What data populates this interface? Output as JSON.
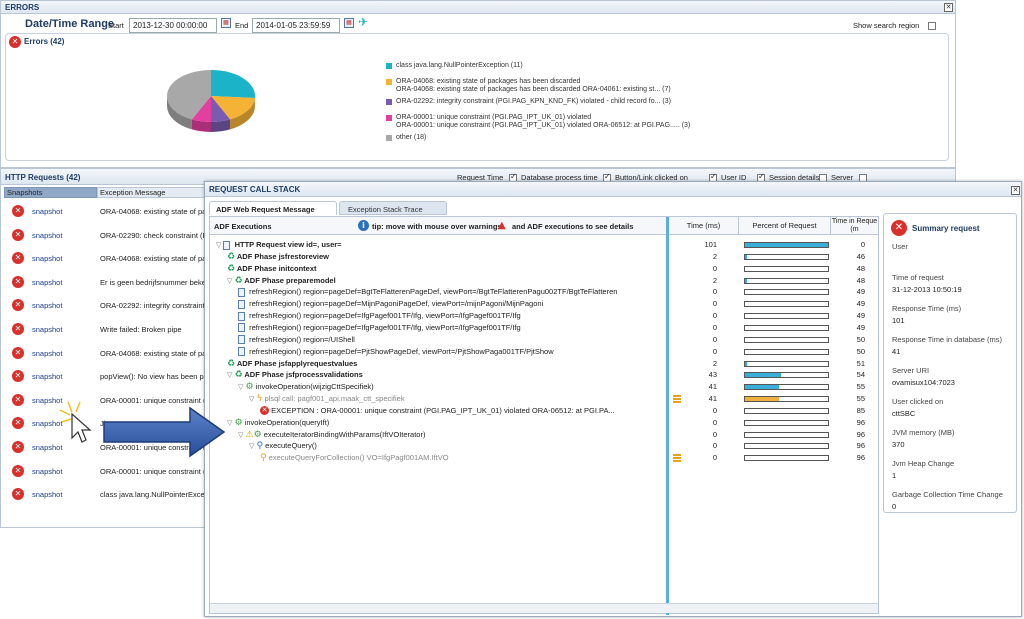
{
  "errors_panel": {
    "title": "ERRORS",
    "date_range_label": "Date/Time Range",
    "start_label": "Start",
    "start_value": "2013-12-30 00:00:00",
    "end_label": "End",
    "end_value": "2014-01-05 23:59:59",
    "show_search_label": "Show search region",
    "errors_count_label": "Errors (42)"
  },
  "chart_data": {
    "type": "pie",
    "categories": [
      "class java.lang.NullPointerException (11)",
      "ORA-04068: existing state of packages has been discarded ORA-04068: existing state of packages has been discarded ORA-04061: existing st... (7)",
      "ORA-02292: integrity constraint (PGI.PAG_KPN_KND_FK) violated - child record fo... (3)",
      "ORA-00001: unique constraint (PGI.PAG_IPT_UK_01) violated ORA-00001: unique constraint (PGI.PAG_IPT_UK_01) violated ORA-06512: at PGI.PAG..... (3)",
      "other (18)"
    ],
    "values": [
      11,
      7,
      3,
      3,
      18
    ],
    "colors": [
      "#1ab3c8",
      "#f5b335",
      "#7b5bb0",
      "#e23fa0",
      "#a8a8a8"
    ]
  },
  "legend": [
    {
      "line1": "class java.lang.NullPointerException (11)",
      "line2": ""
    },
    {
      "line1": "ORA-04068: existing state of packages has been discarded",
      "line2": "ORA-04068: existing state of packages has been discarded ORA-04061: existing st... (7)"
    },
    {
      "line1": "ORA-02292: integrity constraint (PGI.PAG_KPN_KND_FK) violated - child record fo... (3)",
      "line2": ""
    },
    {
      "line1": "ORA-00001: unique constraint (PGI.PAG_IPT_UK_01) violated",
      "line2": "ORA-00001: unique constraint (PGI.PAG_IPT_UK_01) violated ORA-06512: at PGI.PAG..... (3)"
    },
    {
      "line1": "other (18)",
      "line2": ""
    }
  ],
  "http_panel": {
    "title": "HTTP Requests (42)",
    "col_snapshots": "Snapshots",
    "col_exception": "Exception Message",
    "filters": [
      {
        "label": "Request Time",
        "checked": true
      },
      {
        "label": "Database process time",
        "checked": true
      },
      {
        "label": "Button/Link clicked on",
        "checked": true
      },
      {
        "label": "User ID",
        "checked": true
      },
      {
        "label": "Session details",
        "checked": false
      },
      {
        "label": "Server",
        "checked": false
      }
    ],
    "rows": [
      {
        "snap": "snapshot",
        "msg": "ORA-04068: existing state of pa"
      },
      {
        "snap": "snapshot",
        "msg": "ORA-02290: check constraint (F"
      },
      {
        "snap": "snapshot",
        "msg": "ORA-04068: existing state of pa"
      },
      {
        "snap": "snapshot",
        "msg": "Er is geen bedrijfsnummer beker"
      },
      {
        "snap": "snapshot",
        "msg": "ORA-02292: integrity constraint"
      },
      {
        "snap": "snapshot",
        "msg": "Write failed: Broken pipe"
      },
      {
        "snap": "snapshot",
        "msg": "ORA-04068: existing state of pa"
      },
      {
        "snap": "snapshot",
        "msg": "popView(): No view has been p"
      },
      {
        "snap": "snapshot",
        "msg": "ORA-00001: unique constraint ("
      },
      {
        "snap": "snapshot",
        "msg": "Ji"
      },
      {
        "snap": "snapshot",
        "msg": "ORA-00001: unique constraint ("
      },
      {
        "snap": "snapshot",
        "msg": "ORA-00001: unique constraint ("
      },
      {
        "snap": "snapshot",
        "msg": "class java.lang.NullPointerExcep"
      }
    ]
  },
  "call_stack": {
    "title": "REQUEST CALL STACK",
    "tabs": [
      "ADF Web Request Message",
      "Exception Stack Trace"
    ],
    "adf_label": "ADF Executions",
    "tip_a": "tip: move with mouse over warnings",
    "tip_b": "and ADF executions to see details",
    "col_time": "Time (ms)",
    "col_percent": "Percent of Request",
    "col_time_in": "Time in Reque (m",
    "rows": [
      {
        "indent": 0,
        "tri": "▽",
        "icon": "page",
        "bold": true,
        "label": "HTTP Request view id=, user=",
        "time": "101",
        "pct": 100,
        "orange": false,
        "time_in": "0",
        "marker": false,
        "style": "normal"
      },
      {
        "indent": 1,
        "tri": "",
        "icon": "recycle",
        "bold": true,
        "label": "ADF Phase jsfrestoreview",
        "time": "2",
        "pct": 2,
        "orange": false,
        "time_in": "46",
        "marker": false,
        "style": "normal"
      },
      {
        "indent": 1,
        "tri": "",
        "icon": "recycle",
        "bold": true,
        "label": "ADF Phase initcontext",
        "time": "0",
        "pct": 0,
        "orange": false,
        "time_in": "48",
        "marker": false,
        "style": "normal"
      },
      {
        "indent": 1,
        "tri": "▽",
        "icon": "recycle",
        "bold": true,
        "label": "ADF Phase preparemodel",
        "time": "2",
        "pct": 2,
        "orange": false,
        "time_in": "48",
        "marker": false,
        "style": "normal"
      },
      {
        "indent": 2,
        "tri": "",
        "icon": "page",
        "bold": false,
        "label": "refreshRegion() region=pageDef=BgtTeFlatterenPageDef, viewPort=/BgtTeFlatterenPagu002TF/BgtTeFlatteren",
        "time": "0",
        "pct": 0,
        "orange": false,
        "time_in": "49",
        "marker": false,
        "style": "normal"
      },
      {
        "indent": 2,
        "tri": "",
        "icon": "page",
        "bold": false,
        "label": "refreshRegion() region=pageDef=MijnPagoniPageDef, viewPort=/mijnPagoni/MijnPagoni",
        "time": "0",
        "pct": 0,
        "orange": false,
        "time_in": "49",
        "marker": false,
        "style": "normal"
      },
      {
        "indent": 2,
        "tri": "",
        "icon": "page",
        "bold": false,
        "label": "refreshRegion() region=pageDef=IfgPagef001TF/Ifg, viewPort=/IfgPagef001TF/Ifg",
        "time": "0",
        "pct": 0,
        "orange": false,
        "time_in": "49",
        "marker": false,
        "style": "normal"
      },
      {
        "indent": 2,
        "tri": "",
        "icon": "page",
        "bold": false,
        "label": "refreshRegion() region=pageDef=IfgPagef001TF/Ifg, viewPort=/IfgPagef001TF/Ifg",
        "time": "0",
        "pct": 0,
        "orange": false,
        "time_in": "49",
        "marker": false,
        "style": "normal"
      },
      {
        "indent": 2,
        "tri": "",
        "icon": "page",
        "bold": false,
        "label": "refreshRegion() region=/UIShell",
        "time": "0",
        "pct": 0,
        "orange": false,
        "time_in": "50",
        "marker": false,
        "style": "normal"
      },
      {
        "indent": 2,
        "tri": "",
        "icon": "page",
        "bold": false,
        "label": "refreshRegion() region=pageDef=PjtShowPageDef, viewPort=/PjtShowPaga001TF/PjtShow",
        "time": "0",
        "pct": 0,
        "orange": false,
        "time_in": "50",
        "marker": false,
        "style": "normal"
      },
      {
        "indent": 1,
        "tri": "",
        "icon": "recycle",
        "bold": true,
        "label": "ADF Phase jsfapplyrequestvalues",
        "time": "2",
        "pct": 2,
        "orange": false,
        "time_in": "51",
        "marker": false,
        "style": "normal"
      },
      {
        "indent": 1,
        "tri": "▽",
        "icon": "recycle",
        "bold": true,
        "label": "ADF Phase jsfprocessvalidations",
        "time": "43",
        "pct": 43,
        "orange": false,
        "time_in": "54",
        "marker": false,
        "style": "normal"
      },
      {
        "indent": 2,
        "tri": "▽",
        "icon": "gear",
        "bold": false,
        "label": "invokeOperation(wijzigCttSpecifiek)",
        "time": "41",
        "pct": 41,
        "orange": false,
        "time_in": "55",
        "marker": false,
        "style": "normal"
      },
      {
        "indent": 3,
        "tri": "▽",
        "icon": "bolt",
        "bold": false,
        "label": "plsql call: pagf001_api.maak_ctt_specifiek",
        "time": "41",
        "pct": 41,
        "orange": true,
        "time_in": "55",
        "marker": true,
        "style": "muted"
      },
      {
        "indent": 4,
        "tri": "",
        "icon": "err",
        "bold": false,
        "label": "EXCEPTION : ORA-00001: unique constraint (PGI.PAG_IPT_UK_01) violated ORA-06512: at PGI.PA...",
        "time": "0",
        "pct": 0,
        "orange": false,
        "time_in": "85",
        "marker": false,
        "style": "normal"
      },
      {
        "indent": 1,
        "tri": "▽",
        "icon": "gear",
        "bold": false,
        "label": "invokeOperation(queryIft)",
        "time": "0",
        "pct": 0,
        "orange": false,
        "time_in": "96",
        "marker": false,
        "style": "normal"
      },
      {
        "indent": 2,
        "tri": "▽",
        "icon": "warn",
        "bold": false,
        "label": "executeIteratorBindingWithParams(IftVOIterator)",
        "time": "0",
        "pct": 0,
        "orange": false,
        "time_in": "96",
        "marker": false,
        "style": "normal"
      },
      {
        "indent": 3,
        "tri": "▽",
        "icon": "search",
        "bold": false,
        "label": "executeQuery()",
        "time": "0",
        "pct": 0,
        "orange": false,
        "time_in": "96",
        "marker": false,
        "style": "normal"
      },
      {
        "indent": 4,
        "tri": "",
        "icon": "search-orange",
        "bold": false,
        "label": "executeQueryForCollection() VO=IfgPagf001AM.IftVO",
        "time": "0",
        "pct": 0,
        "orange": false,
        "time_in": "96",
        "marker": true,
        "style": "muted"
      }
    ]
  },
  "summary": {
    "title": "Summary request",
    "fields": [
      {
        "label": "User",
        "value": ""
      },
      {
        "label": "Time of request",
        "value": "31-12-2013 10:50:19"
      },
      {
        "label": "Response Time (ms)",
        "value": "101"
      },
      {
        "label": "Response Time in database (ms)",
        "value": "41"
      },
      {
        "label": "Server URI",
        "value": "ovamisux104:7023"
      },
      {
        "label": "User clicked on",
        "value": "cttSBC"
      },
      {
        "label": "JVM memory (MB)",
        "value": "370"
      },
      {
        "label": "Jvm Heap Change",
        "value": "1"
      },
      {
        "label": "Garbage Collection Time Change",
        "value": "0"
      }
    ]
  }
}
